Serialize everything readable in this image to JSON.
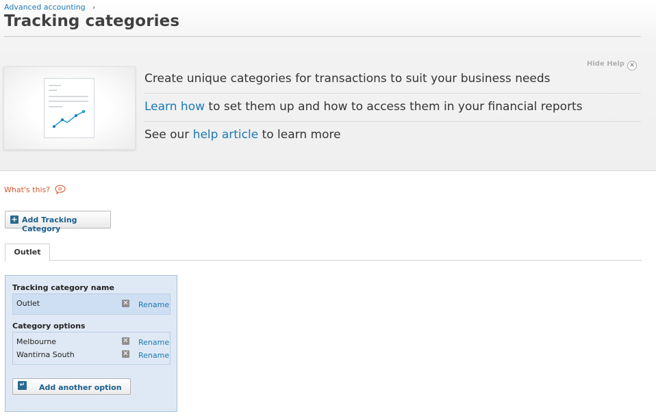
{
  "breadcrumb": {
    "parent": "Advanced accounting",
    "separator": "›"
  },
  "page_title": "Tracking categories",
  "help": {
    "hide_label": "Hide Help",
    "close_glyph": "✕",
    "line1": "Create unique categories for transactions to suit your business needs",
    "line2_link": "Learn how",
    "line2_rest": " to set them up and how to access them in your financial reports",
    "line3_pre": "See our ",
    "line3_link": "help article",
    "line3_post": " to learn more"
  },
  "whats_this": "What's this?",
  "add_tracking_button": {
    "icon": "plus-icon",
    "label": "Add Tracking Category"
  },
  "tabs": [
    {
      "label": "Outlet"
    }
  ],
  "panel": {
    "name_section_label": "Tracking category name",
    "category_name": "Outlet",
    "options_section_label": "Category options",
    "options": [
      {
        "name": "Melbourne"
      },
      {
        "name": "Wantirna South"
      }
    ],
    "rename_label": "Rename",
    "add_option_label": "Add another option"
  },
  "colors": {
    "link": "#1a78b4",
    "whats_this": "#d4572a",
    "panel_bg": "#dfe9f5",
    "panel_border": "#a9bfd6"
  }
}
